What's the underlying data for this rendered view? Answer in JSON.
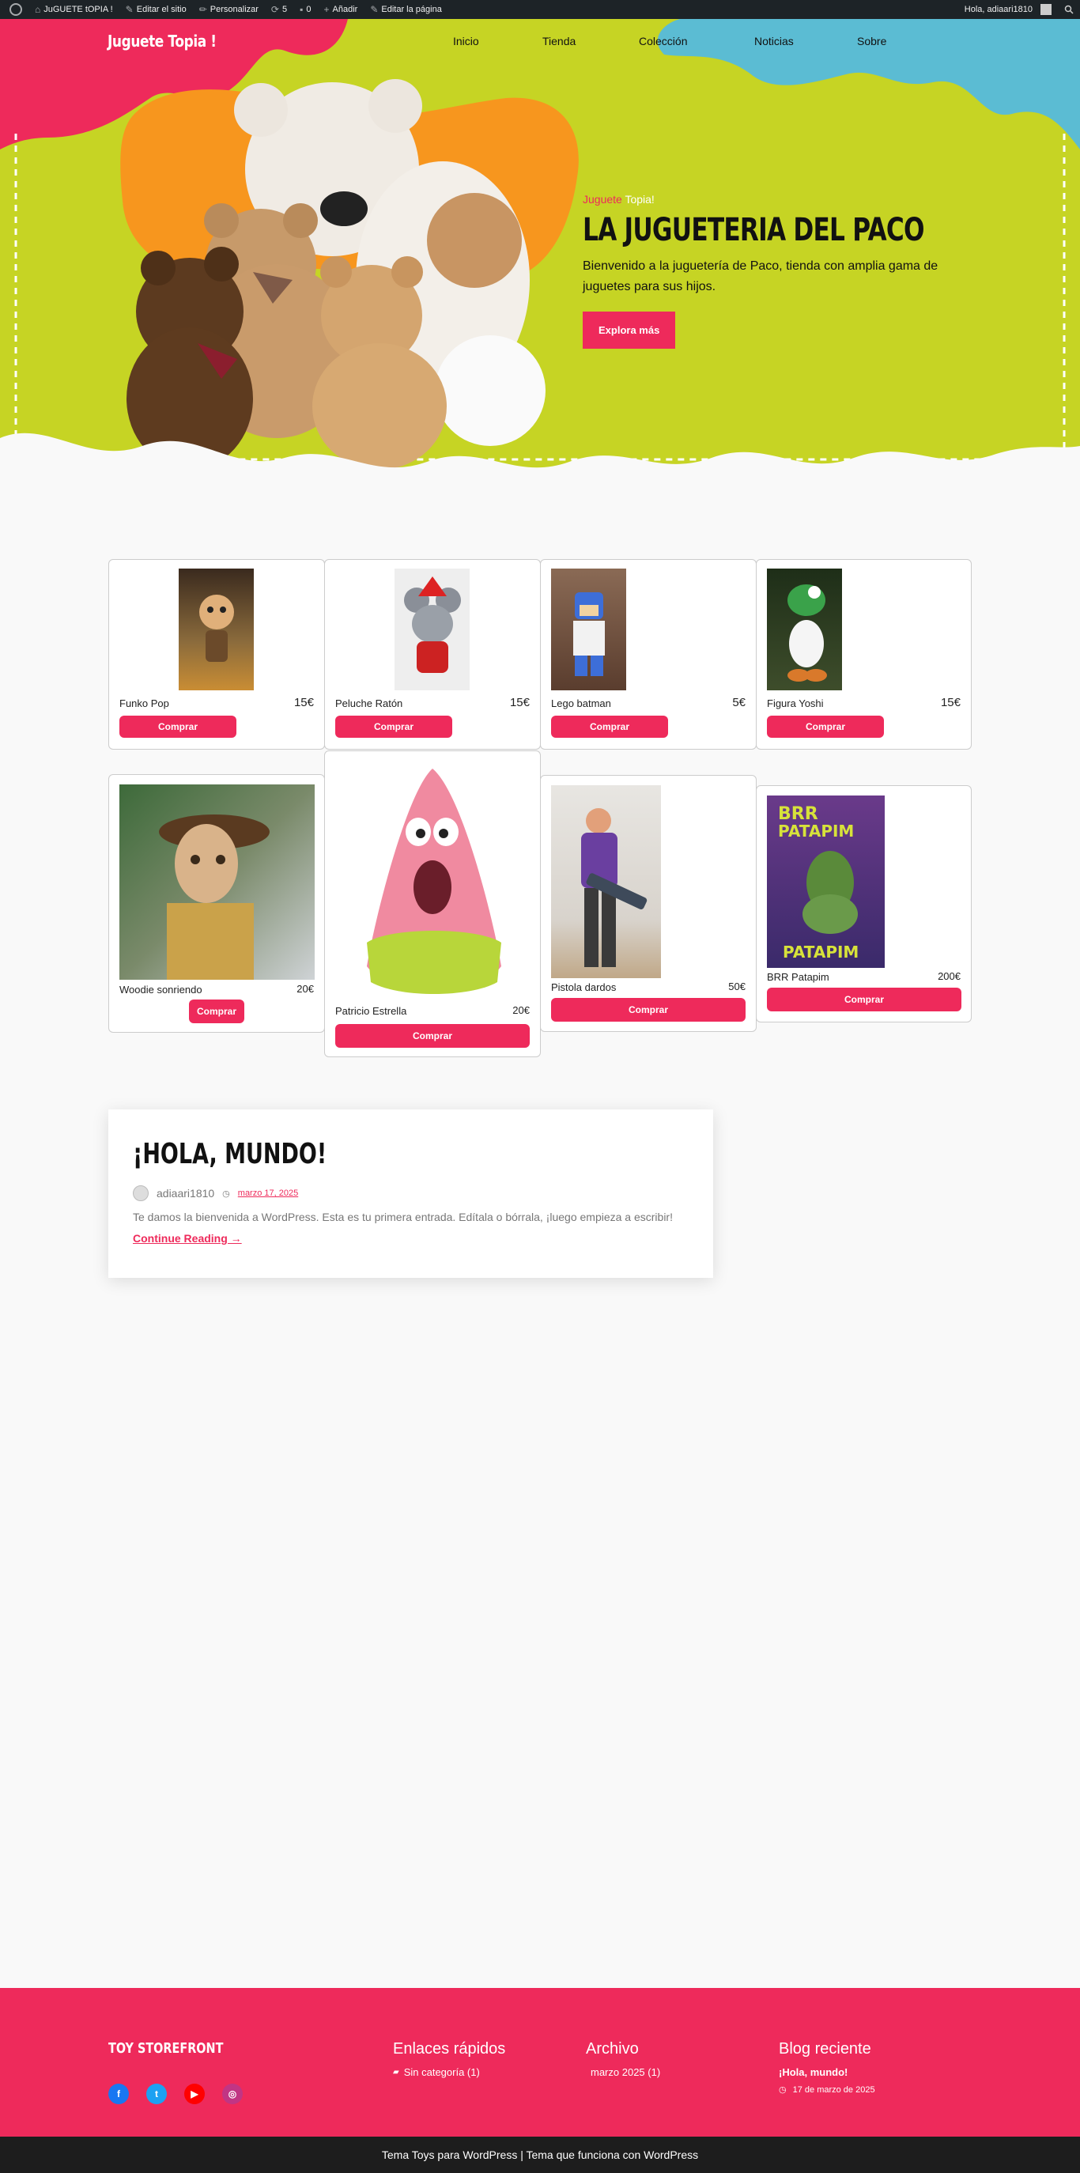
{
  "adminbar": {
    "site_name": "JuGUETE tOPIA !",
    "edit_site": "Editar el sitio",
    "customize": "Personalizar",
    "updates": "5",
    "comments": "0",
    "add": "Añadir",
    "edit_page": "Editar la página",
    "greeting": "Hola, adiaari1810"
  },
  "header": {
    "site_title": "Juguete Topia !",
    "nav": [
      "Inicio",
      "Tienda",
      "Colección",
      "Noticias",
      "Sobre"
    ]
  },
  "hero": {
    "tagline_a": "Juguete",
    "tagline_b": " Topia!",
    "title": "LA JUGUETERIA DEL PACO",
    "description": "Bienvenido a la juguetería de Paco, tienda con amplia gama de juguetes para sus hijos.",
    "button": "Explora más"
  },
  "products": [
    {
      "name": "Funko Pop",
      "price": "15€",
      "button": "Comprar"
    },
    {
      "name": "Peluche Ratón",
      "price": "15€",
      "button": "Comprar"
    },
    {
      "name": "Lego batman",
      "price": "5€",
      "button": "Comprar"
    },
    {
      "name": "Figura Yoshi",
      "price": "15€",
      "button": "Comprar"
    },
    {
      "name": "Woodie sonriendo",
      "price": "20€",
      "button": "Comprar"
    },
    {
      "name": "Patricio Estrella",
      "price": "20€",
      "button": "Comprar"
    },
    {
      "name": "Pistola dardos",
      "price": "50€",
      "button": "Comprar"
    },
    {
      "name": "BRR Patapim",
      "price": "200€",
      "button": "Comprar"
    }
  ],
  "post": {
    "title": "¡HOLA, MUNDO!",
    "author": "adiaari1810",
    "date": "marzo 17, 2025",
    "excerpt": "Te damos la bienvenida a WordPress. Esta es tu primera entrada. Edítala o bórrala, ¡luego empieza a escribir!",
    "more": "Continue Reading →"
  },
  "footer": {
    "brand": "TOY STOREFRONT",
    "quick_title": "Enlaces rápidos",
    "quick_item": "Sin categoría (1)",
    "archive_title": "Archivo",
    "archive_item": "marzo 2025 (1)",
    "recent_title": "Blog reciente",
    "recent_item": "¡Hola, mundo!",
    "recent_date": "17 de marzo de 2025",
    "credits": "Tema Toys para WordPress | Tema que funciona con WordPress"
  },
  "colors": {
    "accent": "#ee2a5b",
    "hero_green": "#c6d424",
    "hero_orange": "#f7961e",
    "hero_blue": "#5bbcd3",
    "dark": "#1d2327"
  }
}
